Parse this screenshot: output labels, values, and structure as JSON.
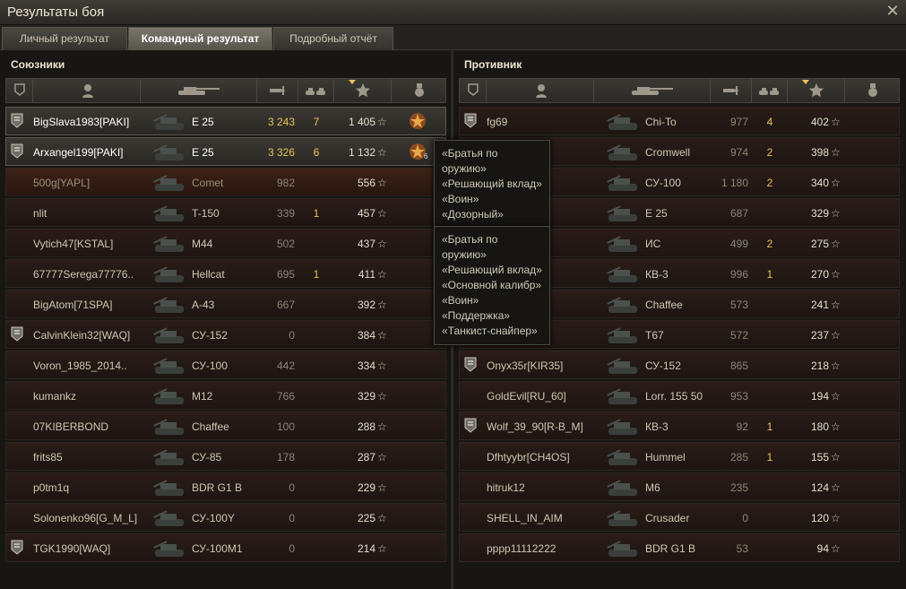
{
  "window": {
    "title": "Результаты боя"
  },
  "tabs": [
    {
      "label": "Личный результат",
      "active": false
    },
    {
      "label": "Командный результат",
      "active": true
    },
    {
      "label": "Подробный отчёт",
      "active": false
    }
  ],
  "allies": {
    "title": "Союзники",
    "rows": [
      {
        "name": "BigSlava1983[PAKI]",
        "vehicle": "E 25",
        "damage": "3 243",
        "kills": "7",
        "xp": "1 405",
        "badge": true,
        "me": true,
        "medal": true
      },
      {
        "name": "Arxangel199[PAKI]",
        "vehicle": "E 25",
        "damage": "3 326",
        "kills": "6",
        "xp": "1 132",
        "badge": true,
        "me": true,
        "medal": true,
        "medal_count": "6"
      },
      {
        "name": "500g[YAPL]",
        "vehicle": "Comet",
        "damage": "982",
        "kills": "",
        "xp": "556",
        "dead": true
      },
      {
        "name": "nlit",
        "vehicle": "T-150",
        "damage": "339",
        "kills": "1",
        "xp": "457"
      },
      {
        "name": "Vytich47[KSTAL]",
        "vehicle": "M44",
        "damage": "502",
        "kills": "",
        "xp": "437"
      },
      {
        "name": "67777Serega77776..",
        "vehicle": "Hellcat",
        "damage": "695",
        "kills": "1",
        "xp": "411"
      },
      {
        "name": "BigAtom[71SPA]",
        "vehicle": "A-43",
        "damage": "667",
        "kills": "",
        "xp": "392"
      },
      {
        "name": "CalvinKlein32[WAQ]",
        "vehicle": "СУ-152",
        "damage": "0",
        "kills": "",
        "xp": "384",
        "badge": true
      },
      {
        "name": "Voron_1985_2014..",
        "vehicle": "СУ-100",
        "damage": "442",
        "kills": "",
        "xp": "334"
      },
      {
        "name": "kumankz",
        "vehicle": "M12",
        "damage": "766",
        "kills": "",
        "xp": "329"
      },
      {
        "name": "07KIBERBOND",
        "vehicle": "Chaffee",
        "damage": "100",
        "kills": "",
        "xp": "288"
      },
      {
        "name": "frits85",
        "vehicle": "СУ-85",
        "damage": "178",
        "kills": "",
        "xp": "287"
      },
      {
        "name": "p0tm1q",
        "vehicle": "BDR G1 B",
        "damage": "0",
        "kills": "",
        "xp": "229"
      },
      {
        "name": "Solonenko96[G_M_L]",
        "vehicle": "СУ-100Y",
        "damage": "0",
        "kills": "",
        "xp": "225"
      },
      {
        "name": "TGK1990[WAQ]",
        "vehicle": "СУ-100М1",
        "damage": "0",
        "kills": "",
        "xp": "214",
        "badge": true
      }
    ]
  },
  "enemies": {
    "title": "Противник",
    "rows": [
      {
        "name": "fg69",
        "vehicle": "Chi-To",
        "damage": "977",
        "kills": "4",
        "xp": "402",
        "badge": true
      },
      {
        "name": "",
        "vehicle": "Cromwell",
        "damage": "974",
        "kills": "2",
        "xp": "398"
      },
      {
        "name": "",
        "vehicle": "СУ-100",
        "damage": "1 180",
        "kills": "2",
        "xp": "340"
      },
      {
        "name": "",
        "vehicle": "E 25",
        "damage": "687",
        "kills": "",
        "xp": "329"
      },
      {
        "name": "",
        "vehicle": "ИС",
        "damage": "499",
        "kills": "2",
        "xp": "275"
      },
      {
        "name": "",
        "vehicle": "КВ-3",
        "damage": "996",
        "kills": "1",
        "xp": "270"
      },
      {
        "name": "",
        "vehicle": "Chaffee",
        "damage": "573",
        "kills": "",
        "xp": "241"
      },
      {
        "name": "",
        "vehicle": "T67",
        "damage": "572",
        "kills": "",
        "xp": "237"
      },
      {
        "name": "Onyx35r[KIR35]",
        "vehicle": "СУ-152",
        "damage": "865",
        "kills": "",
        "xp": "218",
        "badge": true
      },
      {
        "name": "GoldEvil[RU_60]",
        "vehicle": "Lorr. 155 50",
        "damage": "953",
        "kills": "",
        "xp": "194"
      },
      {
        "name": "Wolf_39_90[R-B_M]",
        "vehicle": "КВ-3",
        "damage": "92",
        "kills": "1",
        "xp": "180",
        "badge": true
      },
      {
        "name": "Dfhtyybr[CH4OS]",
        "vehicle": "Hummel",
        "damage": "285",
        "kills": "1",
        "xp": "155"
      },
      {
        "name": "hitruk12",
        "vehicle": "M6",
        "damage": "235",
        "kills": "",
        "xp": "124"
      },
      {
        "name": "SHELL_IN_AIM",
        "vehicle": "Crusader",
        "damage": "0",
        "kills": "",
        "xp": "120"
      },
      {
        "name": "pppp11112222",
        "vehicle": "BDR G1 B",
        "damage": "53",
        "kills": "",
        "xp": "94"
      }
    ]
  },
  "tooltip1": [
    "«Братья по оружию»",
    "«Решающий вклад»",
    "«Воин»",
    "«Дозорный»"
  ],
  "tooltip2": [
    "«Братья по оружию»",
    "«Решающий вклад»",
    "«Основной калибр»",
    "«Воин»",
    "«Поддержка»",
    "«Танкист-снайпер»"
  ],
  "star_glyph": "☆"
}
